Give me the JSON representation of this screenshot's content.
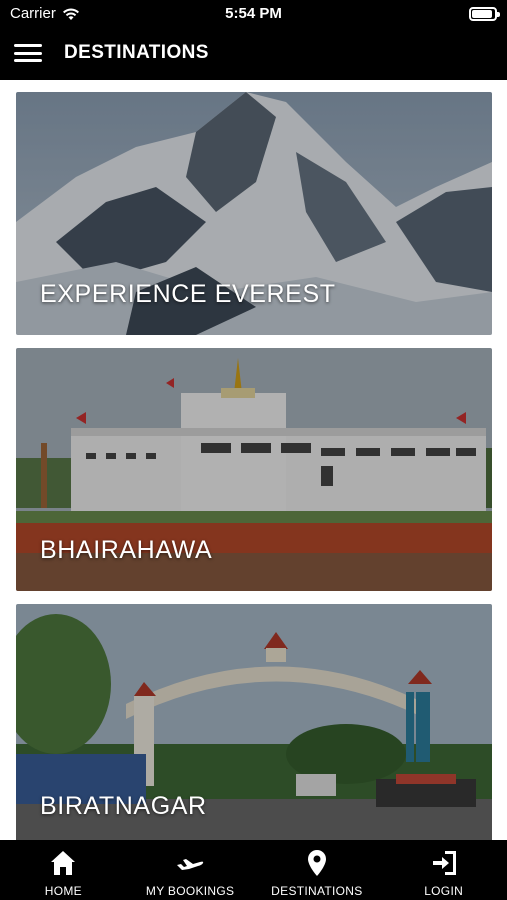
{
  "status_bar": {
    "carrier": "Carrier",
    "time": "5:54 PM",
    "battery_level": 0.9
  },
  "nav": {
    "title": "DESTINATIONS",
    "menu_icon": "hamburger-menu-icon"
  },
  "destinations": [
    {
      "title": "EXPERIENCE EVEREST",
      "image": "snowy-mountain-peak"
    },
    {
      "title": "BHAIRAHAWA",
      "image": "white-temple-by-pond"
    },
    {
      "title": "BIRATNAGAR",
      "image": "city-arch-gateway"
    }
  ],
  "tabs": [
    {
      "label": "HOME",
      "icon": "home-icon"
    },
    {
      "label": "MY BOOKINGS",
      "icon": "airplane-icon"
    },
    {
      "label": "DESTINATIONS",
      "icon": "location-pin-icon"
    },
    {
      "label": "LOGIN",
      "icon": "login-icon"
    }
  ]
}
